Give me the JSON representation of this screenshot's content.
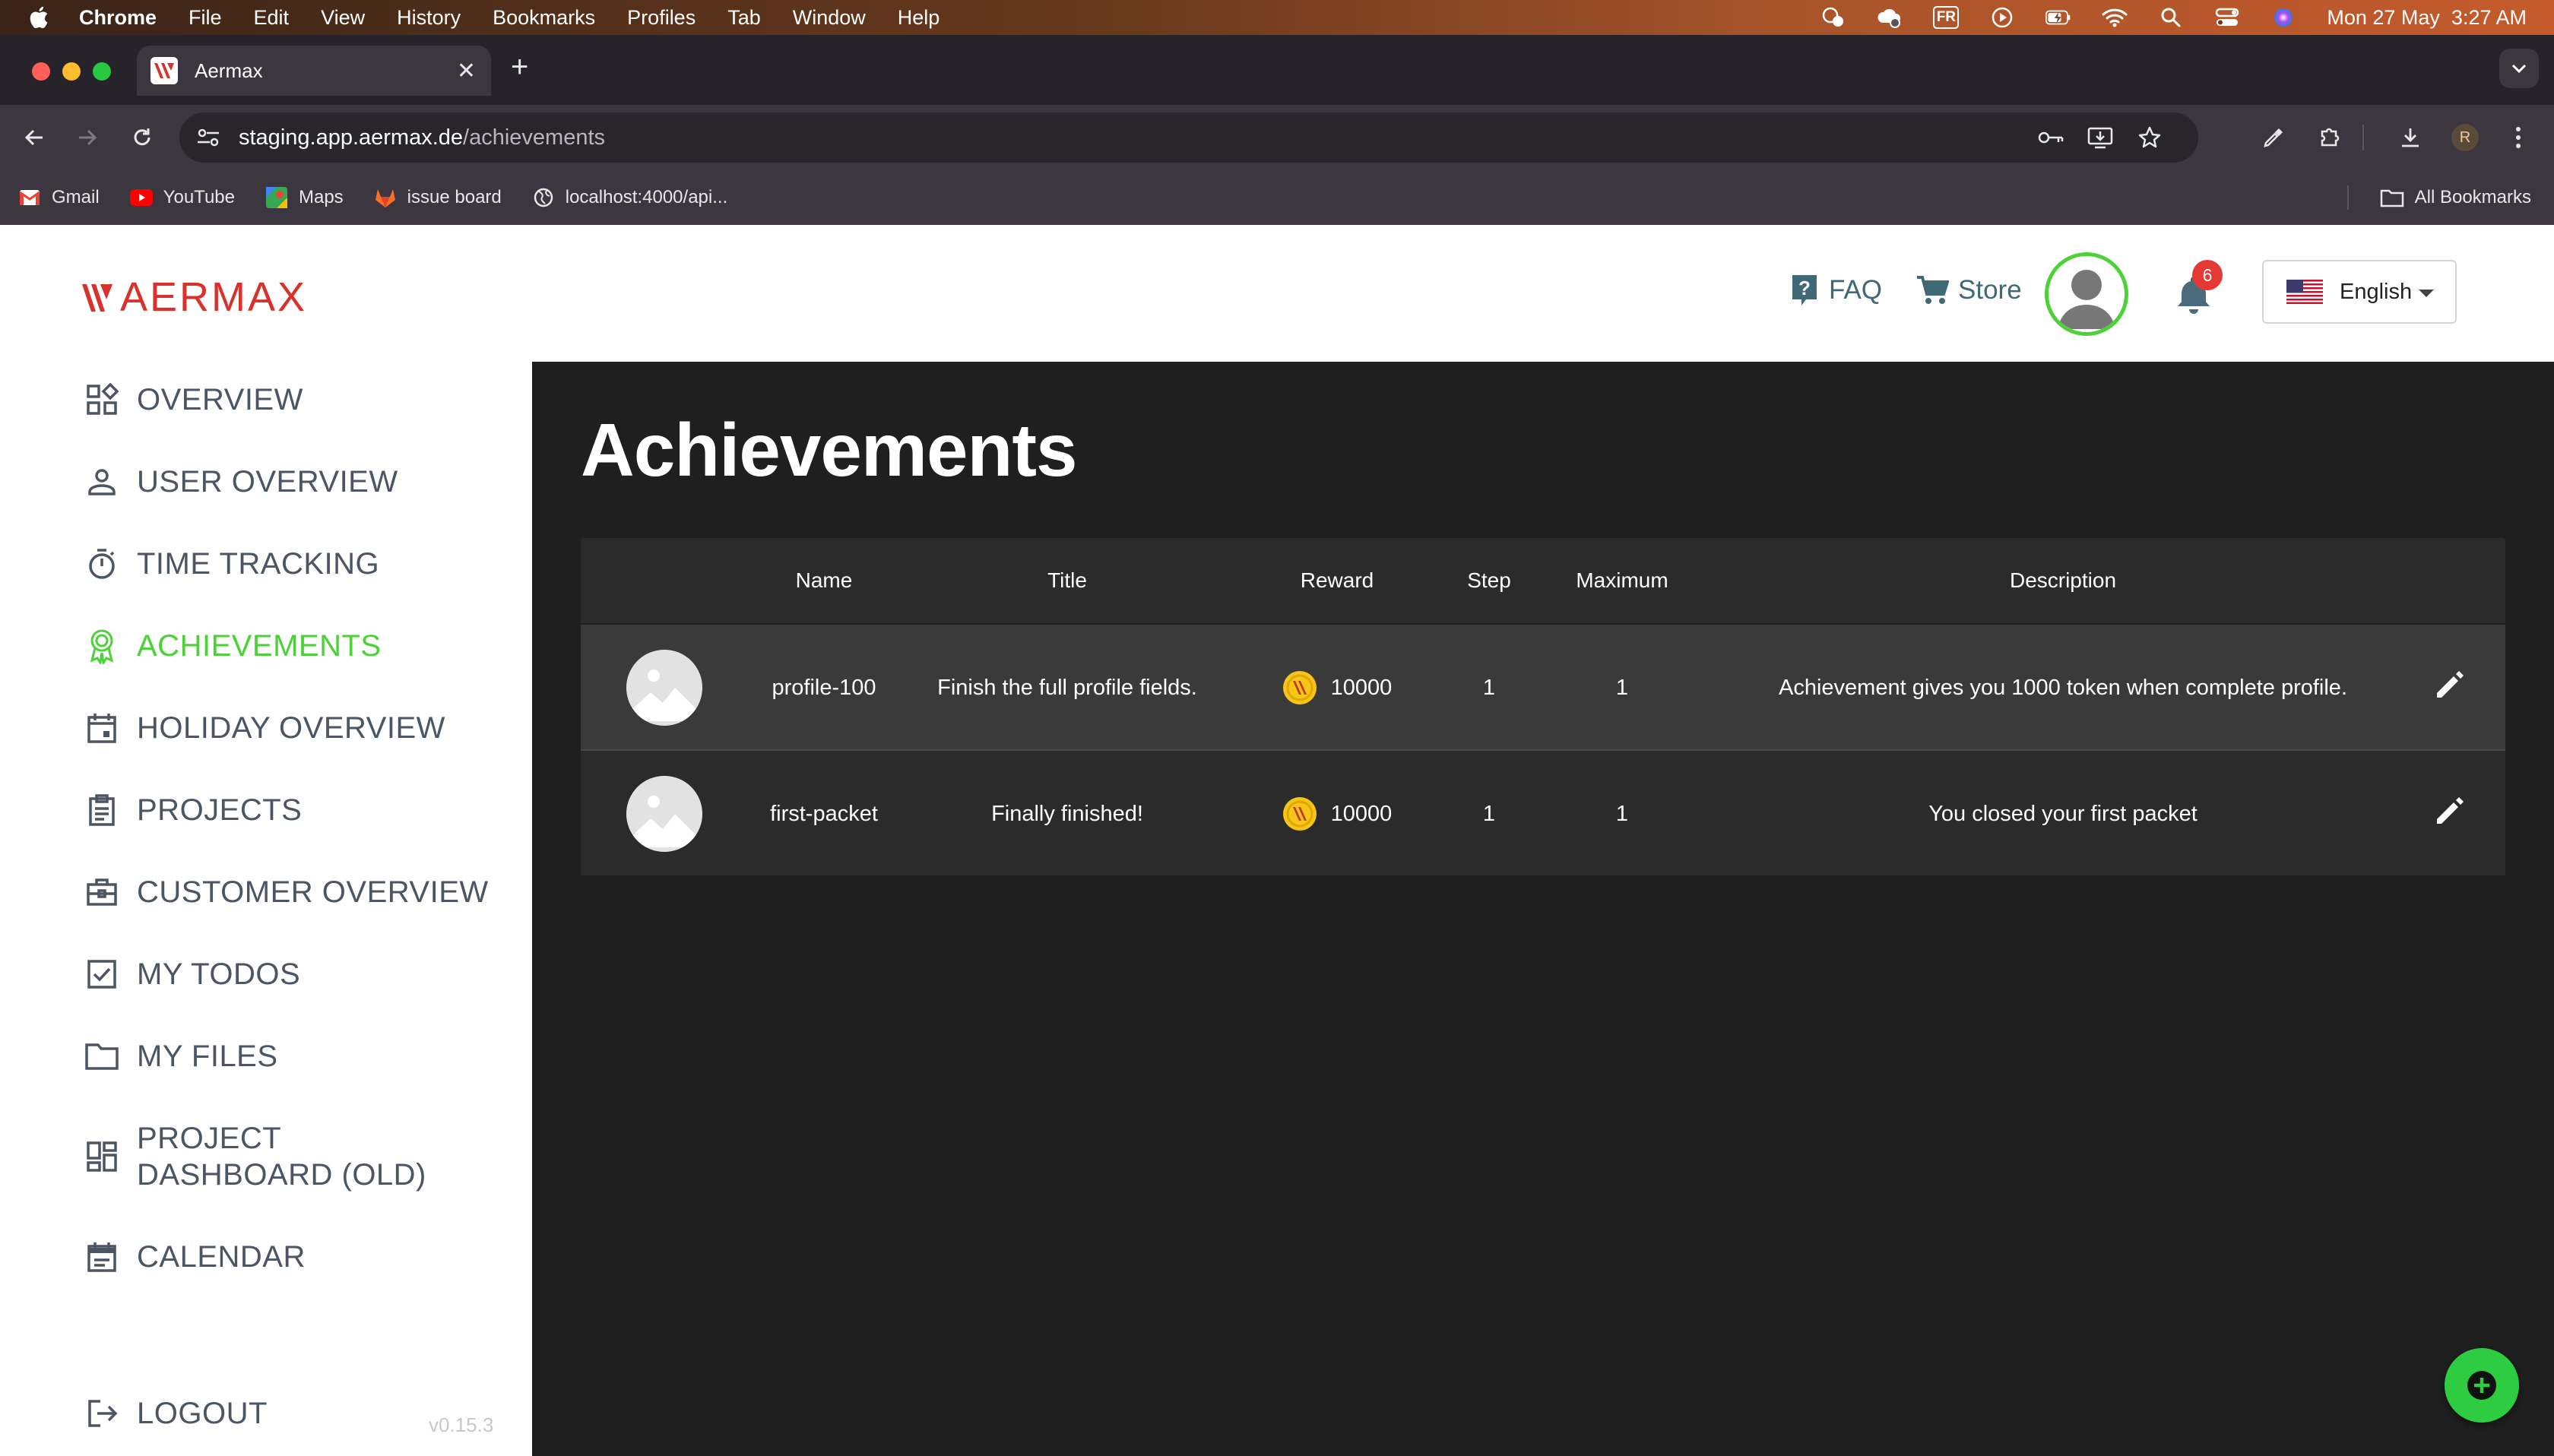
{
  "macos": {
    "menu": [
      "Chrome",
      "File",
      "Edit",
      "View",
      "History",
      "Bookmarks",
      "Profiles",
      "Tab",
      "Window",
      "Help"
    ],
    "input_source": "FR",
    "clock": "Mon 27 May  3:27 AM"
  },
  "browser": {
    "tab_title": "Aermax",
    "url_host": "staging.app.aermax.de",
    "url_path": "/achievements",
    "profile_initial": "R",
    "bookmarks": [
      {
        "label": "Gmail",
        "icon": "gmail-icon"
      },
      {
        "label": "YouTube",
        "icon": "youtube-icon"
      },
      {
        "label": "Maps",
        "icon": "maps-icon"
      },
      {
        "label": "issue board",
        "icon": "gitlab-icon"
      },
      {
        "label": "localhost:4000/api...",
        "icon": "globe-icon"
      }
    ],
    "all_bookmarks": "All Bookmarks"
  },
  "header": {
    "logo_text": "AERMAX",
    "faq": "FAQ",
    "store": "Store",
    "notifications_count": "6",
    "language": "English"
  },
  "sidebar": {
    "items": [
      {
        "label": "OVERVIEW",
        "icon": "dashboard-icon"
      },
      {
        "label": "USER OVERVIEW",
        "icon": "person-icon"
      },
      {
        "label": "TIME TRACKING",
        "icon": "timer-icon"
      },
      {
        "label": "ACHIEVEMENTS",
        "icon": "award-icon",
        "active": true
      },
      {
        "label": "HOLIDAY OVERVIEW",
        "icon": "calendar-event-icon"
      },
      {
        "label": "PROJECTS",
        "icon": "clipboard-icon"
      },
      {
        "label": "CUSTOMER OVERVIEW",
        "icon": "briefcase-icon"
      },
      {
        "label": "MY TODOS",
        "icon": "checkbox-icon"
      },
      {
        "label": "MY FILES",
        "icon": "folder-icon"
      },
      {
        "label": "PROJECT DASHBOARD (OLD)",
        "icon": "grid-dashboard-icon"
      },
      {
        "label": "CALENDAR",
        "icon": "calendar-icon"
      }
    ],
    "logout": "LOGOUT",
    "version": "v0.15.3"
  },
  "main": {
    "title": "Achievements",
    "columns": [
      "Name",
      "Title",
      "Reward",
      "Step",
      "Maximum",
      "Description"
    ],
    "rows": [
      {
        "name": "profile-100",
        "title": "Finish the full profile fields.",
        "reward": "10000",
        "step": "1",
        "maximum": "1",
        "description": "Achievement gives you 1000 token when complete profile."
      },
      {
        "name": "first-packet",
        "title": "Finally finished!",
        "reward": "10000",
        "step": "1",
        "maximum": "1",
        "description": "You closed your first packet"
      }
    ]
  },
  "colors": {
    "accent_green": "#4cd137",
    "brand_red": "#d9312c",
    "notification_red": "#e53935",
    "fab_green": "#2ecc40"
  }
}
